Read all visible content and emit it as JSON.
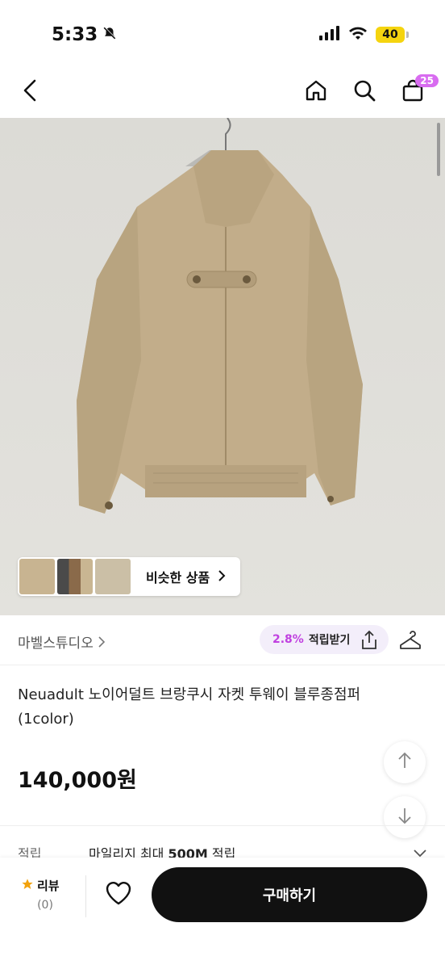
{
  "status_bar": {
    "time": "5:33",
    "battery": "40"
  },
  "nav": {
    "cart_count": "25"
  },
  "similar": {
    "label": "비슷한 상품"
  },
  "store": {
    "name": "마벨스튜디오",
    "reward_rate": "2.8%",
    "reward_label": "적립받기"
  },
  "product": {
    "title": "Neuadult 노이어덜트 브랑쿠시 자켓 투웨이 블루종점퍼 (1color)",
    "price": "140,000원"
  },
  "mileage": {
    "key": "적립",
    "value_prefix": "마일리지 최대 ",
    "value_bold": "500M",
    "value_suffix": " 적립"
  },
  "bottom": {
    "review_label": "리뷰",
    "review_count": "(0)",
    "buy_label": "구매하기"
  },
  "colors": {
    "accent": "#c040e0",
    "badge": "#d86cf0",
    "buy_button": "#111111",
    "star": "#f2a20c"
  }
}
